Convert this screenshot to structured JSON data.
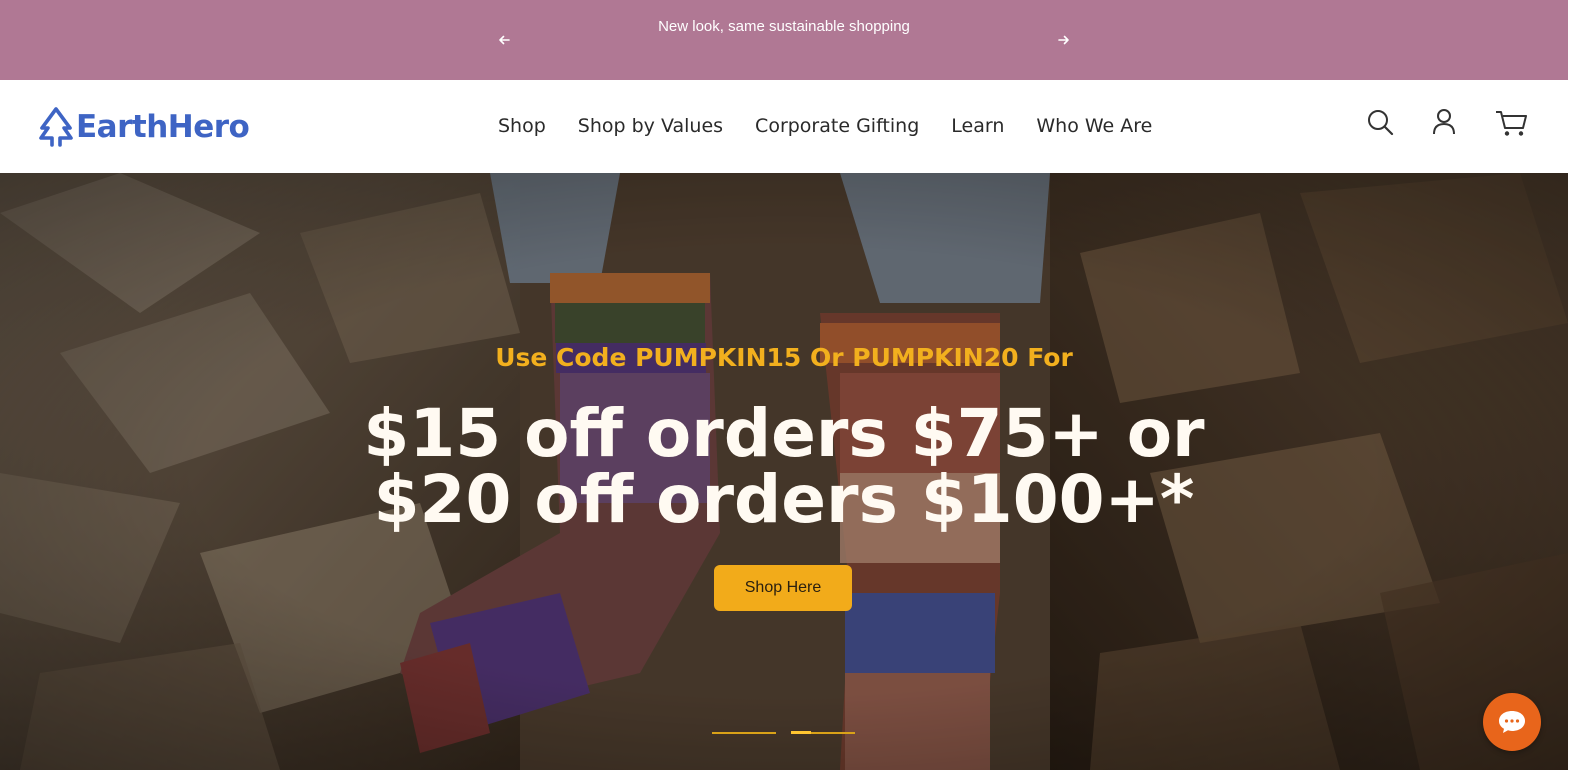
{
  "announcement": {
    "message": "New look, same sustainable shopping",
    "prev_icon": "arrow-left-icon",
    "next_icon": "arrow-right-icon",
    "background_color": "#b07894"
  },
  "header": {
    "logo_text": "EarthHero",
    "logo_icon": "tree-outline-icon",
    "brand_color": "#3e64c4",
    "nav": [
      {
        "label": "Shop"
      },
      {
        "label": "Shop by Values"
      },
      {
        "label": "Corporate Gifting"
      },
      {
        "label": "Learn"
      },
      {
        "label": "Who We Are"
      }
    ],
    "icons": [
      "search-icon",
      "account-icon",
      "cart-icon"
    ]
  },
  "hero": {
    "eyebrow": "Use Code PUMPKIN15 Or PUMPKIN20 For",
    "headline_line1": "$15 off orders $75+ or",
    "headline_line2": "$20 off orders $100+*",
    "cta_label": "Shop Here",
    "eyebrow_color": "#f2b01e",
    "cta_color": "#f2ab1a",
    "slides_total": 2,
    "active_slide": 2
  },
  "chat": {
    "icon": "chat-bubble-icon",
    "color": "#e8651b"
  }
}
